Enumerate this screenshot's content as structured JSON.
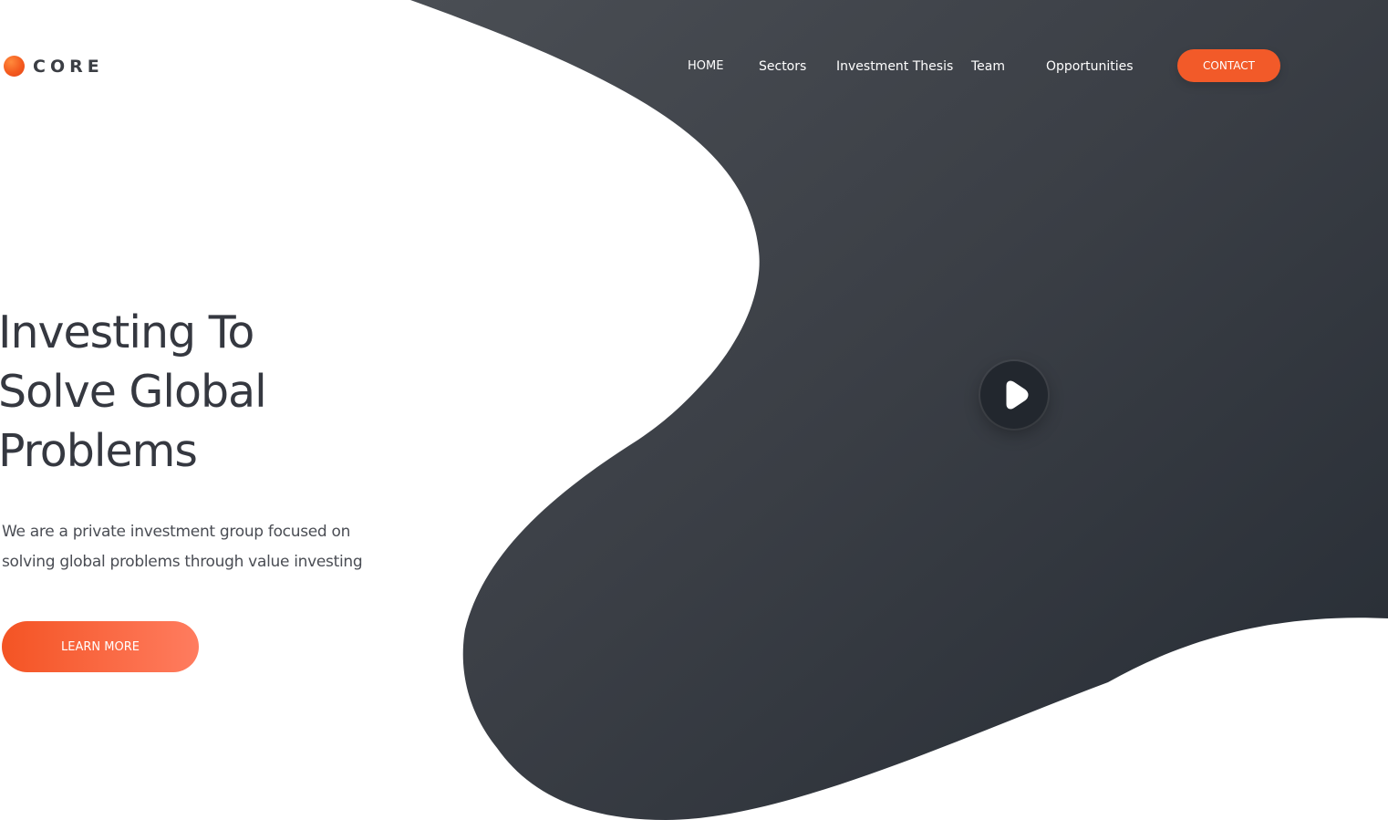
{
  "logo": {
    "text": "CORE",
    "icon": "orange-circle-logo-icon"
  },
  "nav": {
    "items": [
      {
        "label": "HOME",
        "active": true
      },
      {
        "label": "Sectors"
      },
      {
        "label": "Investment Thesis"
      },
      {
        "label": "Team"
      },
      {
        "label": "Opportunities"
      }
    ],
    "contact_label": "CONTACT"
  },
  "hero": {
    "title_lines": [
      "Investing To",
      "Solve Global",
      "Problems"
    ],
    "subtitle_lines": [
      "We are a private investment group focused on",
      "solving global problems through value investing"
    ],
    "cta_label": "LEARN MORE"
  },
  "media": {
    "play_icon": "play-icon"
  },
  "colors": {
    "accent": "#f25a29",
    "dark_panel": "#3a3f46",
    "dark_panel_end": "#2a3038",
    "heading": "#353840"
  }
}
